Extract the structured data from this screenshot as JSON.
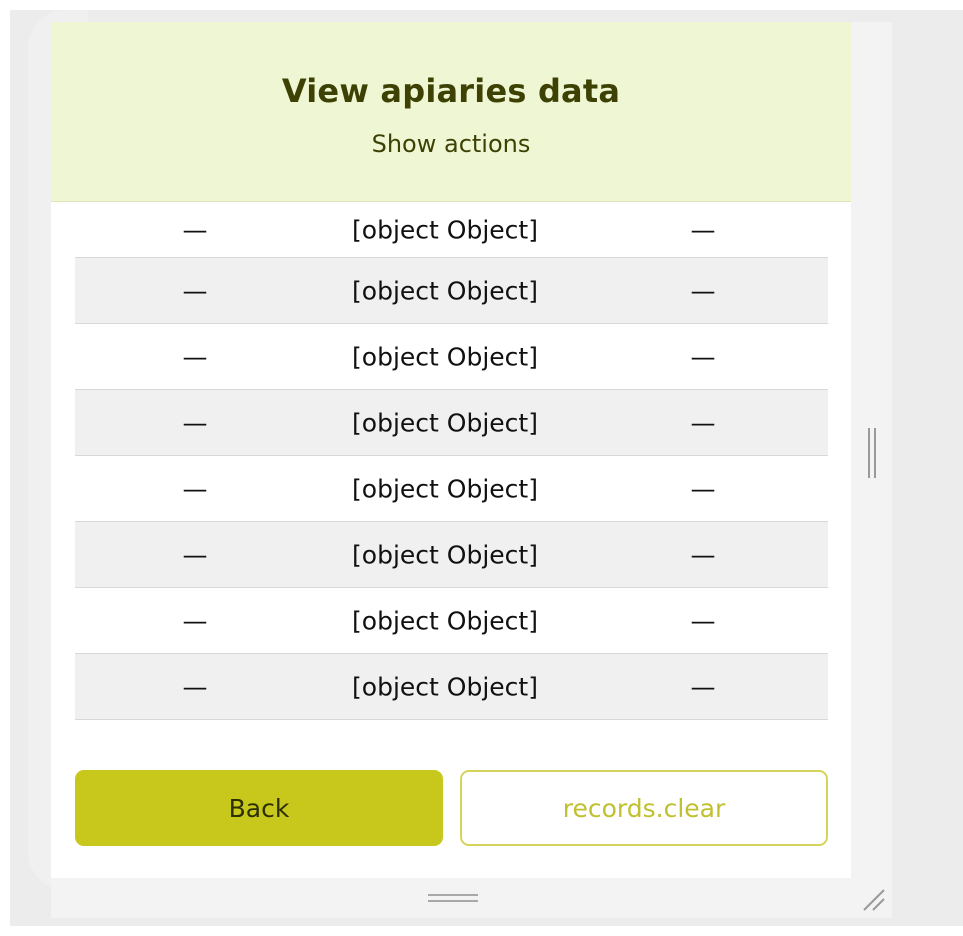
{
  "header": {
    "title": "View apiaries data",
    "subtitle": "Show actions"
  },
  "table": {
    "rows": [
      [
        "—",
        "[object Object]",
        "—"
      ],
      [
        "—",
        "[object Object]",
        "—"
      ],
      [
        "—",
        "[object Object]",
        "—"
      ],
      [
        "—",
        "[object Object]",
        "—"
      ],
      [
        "—",
        "[object Object]",
        "—"
      ],
      [
        "—",
        "[object Object]",
        "—"
      ],
      [
        "—",
        "[object Object]",
        "—"
      ],
      [
        "—",
        "[object Object]",
        "—"
      ]
    ]
  },
  "buttons": {
    "back_label": "Back",
    "clear_label": "records.clear"
  },
  "colors": {
    "header_bg": "#eff6d3",
    "title_text": "#3d4204",
    "primary_button": "#c8c81c",
    "secondary_border": "#d4d45a",
    "alt_row": "#f0f0f0"
  },
  "icons": {
    "right_resize": "vertical-grip-icon",
    "bottom_resize": "horizontal-grip-icon",
    "corner_resize": "resize-corner-icon"
  }
}
